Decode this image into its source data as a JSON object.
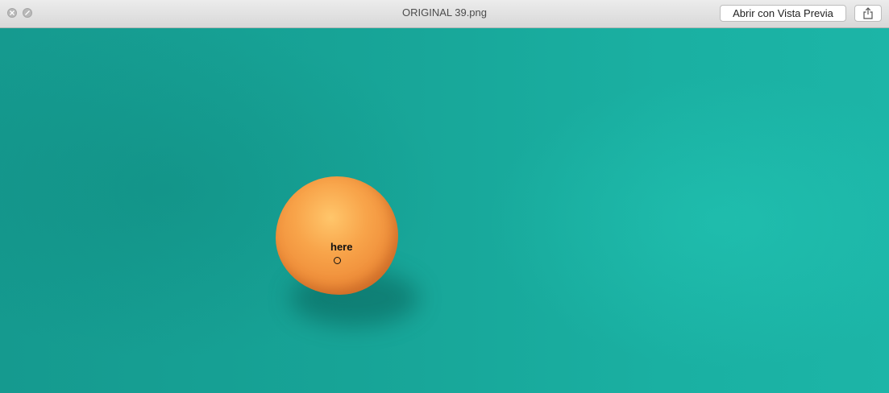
{
  "window": {
    "title": "ORIGINAL 39.png"
  },
  "toolbar": {
    "open_with_preview_label": "Abrir con Vista Previa",
    "share_icon": "share-icon"
  },
  "image": {
    "annotation_text": "here",
    "background_color": "#1aa89c",
    "object_color": "#f59b45"
  }
}
